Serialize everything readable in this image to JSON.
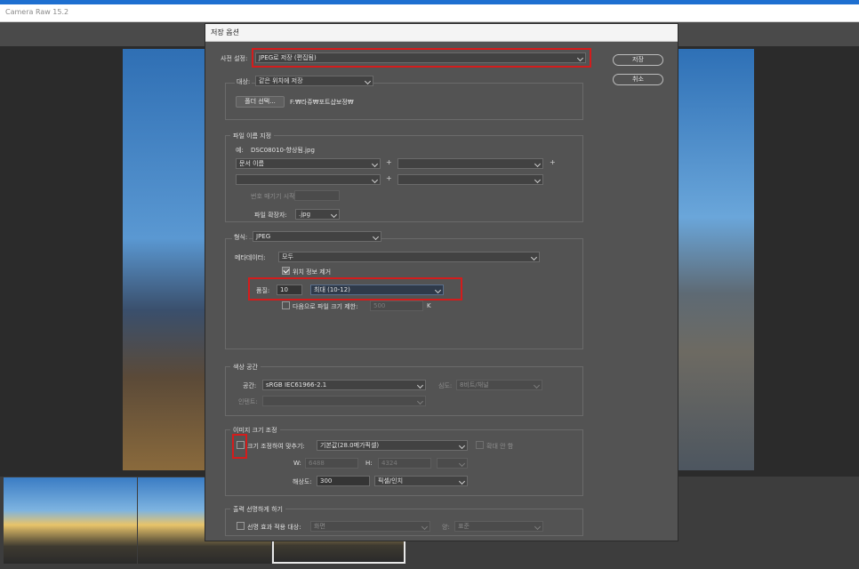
{
  "app": {
    "title": "Camera Raw 15.2"
  },
  "dialog": {
    "title": "저장 옵션",
    "save_label": "저장",
    "cancel_label": "취소",
    "preset_label": "사전 설정:",
    "preset_value": "JPEG로 저장 (편집됨)"
  },
  "destination": {
    "label": "대상:",
    "value": "같은 위치에 저장",
    "folder_button": "폴더 선택...",
    "path": "F:₩라쥬₩포트샵보정₩"
  },
  "file_naming": {
    "title": "파일 이름 지정",
    "example_prefix": "예:",
    "example_name": "DSC08010-향상됨.jpg",
    "field1": "문서 이름",
    "plus": "+",
    "seq_label": "번호 매기기 시작:",
    "ext_label": "파일 확장자:",
    "ext_value": ".jpg"
  },
  "format": {
    "label": "형식:",
    "value": "JPEG",
    "metadata_label": "메타데이터:",
    "metadata_value": "모두",
    "remove_location": "위치 정보 제거",
    "quality_label": "품질:",
    "quality_value": "10",
    "quality_preset": "최대 (10-12)",
    "limit_label": "다음으로 파일 크기 제한:",
    "limit_value": "500",
    "limit_unit": "K"
  },
  "color_space": {
    "title": "색상 공간",
    "space_label": "공간:",
    "space_value": "sRGB IEC61966-2.1",
    "depth_label": "심도:",
    "depth_value": "8비트/채널",
    "intent_label": "인텐트:"
  },
  "resize": {
    "title": "이미지 크기 조정",
    "fit_label": "크기 조정하여 맞추기:",
    "fit_value": "기본값(28.0메가픽셀)",
    "no_enlarge": "확대 안 함",
    "w_label": "W:",
    "w_value": "6488",
    "h_label": "H:",
    "h_value": "4324",
    "res_label": "해상도:",
    "res_value": "300",
    "res_unit": "픽셀/인치"
  },
  "sharpen": {
    "title": "출력 선명하게 하기",
    "for_label": "선명 효과 적용 대상:",
    "for_value": "화면",
    "amount_label": "양:",
    "amount_value": "표준"
  },
  "colors": {
    "highlight": "#d41c1c",
    "dialog_bg": "#535353"
  }
}
